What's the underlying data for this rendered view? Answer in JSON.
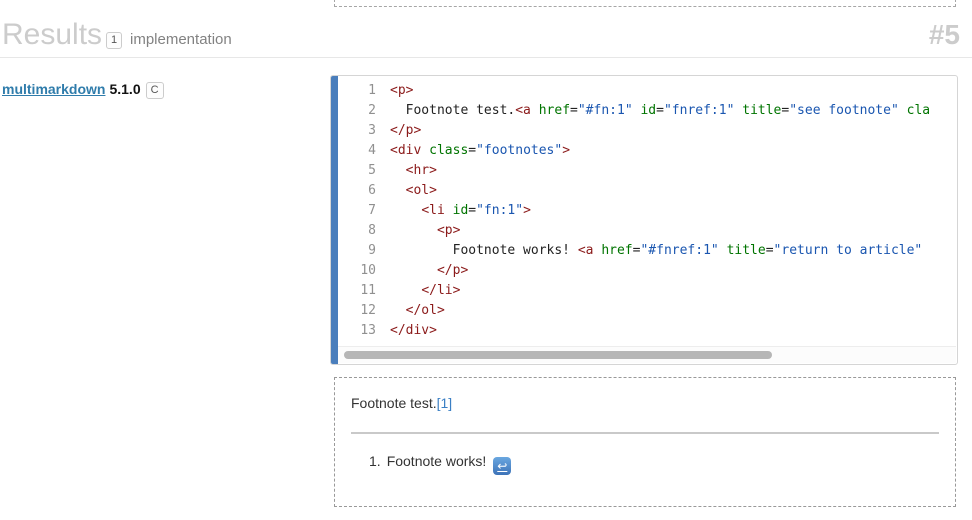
{
  "header": {
    "title": "Results",
    "count_badge": "1",
    "subtitle": "implementation",
    "result_number": "#5"
  },
  "implementation": {
    "name": "multimarkdown",
    "version": "5.1.0",
    "lang_badge": "C"
  },
  "code_block": {
    "lines": [
      {
        "number": "1",
        "tokens": [
          {
            "t": "tag",
            "v": "<p>"
          }
        ]
      },
      {
        "number": "2",
        "tokens": [
          {
            "t": "text",
            "v": "  Footnote test."
          },
          {
            "t": "tag",
            "v": "<a"
          },
          {
            "t": "text",
            "v": " "
          },
          {
            "t": "attr",
            "v": "href"
          },
          {
            "t": "text",
            "v": "="
          },
          {
            "t": "str",
            "v": "\"#fn:1\""
          },
          {
            "t": "text",
            "v": " "
          },
          {
            "t": "attr",
            "v": "id"
          },
          {
            "t": "text",
            "v": "="
          },
          {
            "t": "str",
            "v": "\"fnref:1\""
          },
          {
            "t": "text",
            "v": " "
          },
          {
            "t": "attr",
            "v": "title"
          },
          {
            "t": "text",
            "v": "="
          },
          {
            "t": "str",
            "v": "\"see footnote\""
          },
          {
            "t": "text",
            "v": " "
          },
          {
            "t": "attr",
            "v": "cla"
          }
        ]
      },
      {
        "number": "3",
        "tokens": [
          {
            "t": "tag",
            "v": "</p>"
          }
        ]
      },
      {
        "number": "4",
        "tokens": [
          {
            "t": "tag",
            "v": "<div"
          },
          {
            "t": "text",
            "v": " "
          },
          {
            "t": "attr",
            "v": "class"
          },
          {
            "t": "text",
            "v": "="
          },
          {
            "t": "str",
            "v": "\"footnotes\""
          },
          {
            "t": "tag",
            "v": ">"
          }
        ]
      },
      {
        "number": "5",
        "tokens": [
          {
            "t": "text",
            "v": "  "
          },
          {
            "t": "tag",
            "v": "<hr>"
          }
        ]
      },
      {
        "number": "6",
        "tokens": [
          {
            "t": "text",
            "v": "  "
          },
          {
            "t": "tag",
            "v": "<ol>"
          }
        ]
      },
      {
        "number": "7",
        "tokens": [
          {
            "t": "text",
            "v": "    "
          },
          {
            "t": "tag",
            "v": "<li"
          },
          {
            "t": "text",
            "v": " "
          },
          {
            "t": "attr",
            "v": "id"
          },
          {
            "t": "text",
            "v": "="
          },
          {
            "t": "str",
            "v": "\"fn:1\""
          },
          {
            "t": "tag",
            "v": ">"
          }
        ]
      },
      {
        "number": "8",
        "tokens": [
          {
            "t": "text",
            "v": "      "
          },
          {
            "t": "tag",
            "v": "<p>"
          }
        ]
      },
      {
        "number": "9",
        "tokens": [
          {
            "t": "text",
            "v": "        Footnote works! "
          },
          {
            "t": "tag",
            "v": "<a"
          },
          {
            "t": "text",
            "v": " "
          },
          {
            "t": "attr",
            "v": "href"
          },
          {
            "t": "text",
            "v": "="
          },
          {
            "t": "str",
            "v": "\"#fnref:1\""
          },
          {
            "t": "text",
            "v": " "
          },
          {
            "t": "attr",
            "v": "title"
          },
          {
            "t": "text",
            "v": "="
          },
          {
            "t": "str",
            "v": "\"return to article\""
          }
        ]
      },
      {
        "number": "10",
        "tokens": [
          {
            "t": "text",
            "v": "      "
          },
          {
            "t": "tag",
            "v": "</p>"
          }
        ]
      },
      {
        "number": "11",
        "tokens": [
          {
            "t": "text",
            "v": "    "
          },
          {
            "t": "tag",
            "v": "</li>"
          }
        ]
      },
      {
        "number": "12",
        "tokens": [
          {
            "t": "text",
            "v": "  "
          },
          {
            "t": "tag",
            "v": "</ol>"
          }
        ]
      },
      {
        "number": "13",
        "tokens": [
          {
            "t": "tag",
            "v": "</div>"
          }
        ]
      }
    ]
  },
  "preview": {
    "paragraph_text": "Footnote test.",
    "footnote_ref": "[1]",
    "list_item": {
      "marker": "1.",
      "text": "Footnote works!",
      "icon_glyph": "↩"
    }
  },
  "colors": {
    "accent_bar": "#4a7ebc",
    "implementation_link": "#2f7cab",
    "muted_heading": "#cccccc",
    "code_tag": "#8b1a1a",
    "code_attr": "#007400",
    "code_string": "#1a56b0",
    "footnote_link": "#3b7fc4",
    "return_icon": "#3d73b8"
  }
}
